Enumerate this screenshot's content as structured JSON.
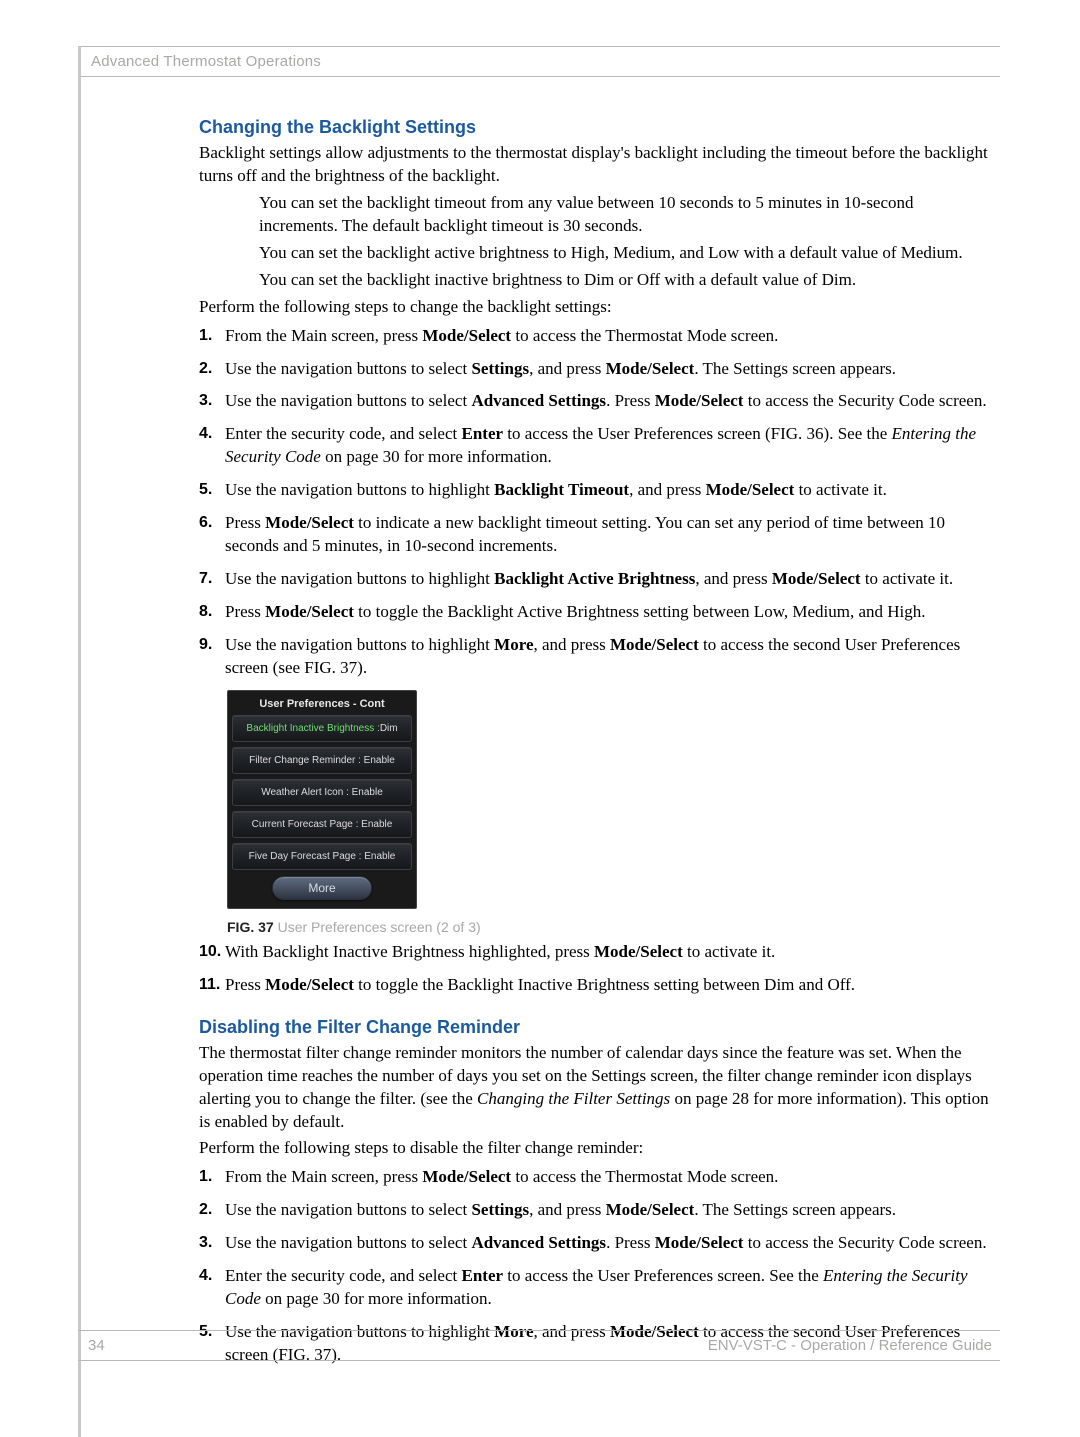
{
  "header": {
    "chapter": "Advanced Thermostat Operations"
  },
  "footer": {
    "page": "34",
    "guide": "ENV-VST-C - Operation / Reference Guide"
  },
  "section1": {
    "title": "Changing the Backlight Settings",
    "intro": "Backlight settings allow adjustments to the thermostat display's backlight including the timeout before the backlight turns off and the brightness of the backlight.",
    "bullets": {
      "b1": "You can set the backlight timeout from any value between 10 seconds to 5 minutes in 10-second increments. The default backlight timeout is 30 seconds.",
      "b2": "You can set the backlight active brightness to High, Medium, and Low with a default value of Medium.",
      "b3": "You can set the backlight inactive brightness to Dim or Off with a default value of Dim."
    },
    "lead": "Perform the following steps to change the backlight settings:",
    "steps": {
      "s1a": "From the Main screen, press ",
      "s1b": "Mode/Select",
      "s1c": " to access the Thermostat Mode screen.",
      "s2a": "Use the navigation buttons to select ",
      "s2b": "Settings",
      "s2c": ", and press ",
      "s2d": "Mode/Select",
      "s2e": ". The Settings screen appears.",
      "s3a": "Use the navigation buttons to select ",
      "s3b": "Advanced Settings",
      "s3c": ". Press ",
      "s3d": "Mode/Select",
      "s3e": " to access the Security Code screen.",
      "s4a": "Enter the security code, and select ",
      "s4b": "Enter",
      "s4c": " to access the User Preferences screen (FIG. 36). See the ",
      "s4d": "Entering the Security Code",
      "s4e": "  on page 30 for more information.",
      "s5a": "Use the navigation buttons to highlight ",
      "s5b": "Backlight Timeout",
      "s5c": ", and press ",
      "s5d": "Mode/Select",
      "s5e": " to activate it.",
      "s6a": "Press ",
      "s6b": "Mode/Select",
      "s6c": " to indicate a new backlight timeout setting. You can set any period of time between 10 seconds and 5 minutes, in 10-second increments.",
      "s7a": "Use the navigation buttons to highlight ",
      "s7b": "Backlight Active Brightness",
      "s7c": ", and press ",
      "s7d": "Mode/Select",
      "s7e": " to activate it.",
      "s8a": "Press ",
      "s8b": "Mode/Select",
      "s8c": " to toggle the Backlight Active Brightness setting between Low, Medium, and High.",
      "s9a": "Use the navigation buttons to highlight ",
      "s9b": "More",
      "s9c": ", and press ",
      "s9d": "Mode/Select",
      "s9e": " to access the second User Preferences screen (see FIG. 37).",
      "s10a": "With Backlight Inactive Brightness highlighted, press ",
      "s10b": "Mode/Select",
      "s10c": " to activate it.",
      "s11a": "Press ",
      "s11b": "Mode/Select",
      "s11c": " to toggle the Backlight Inactive Brightness setting between Dim and Off."
    }
  },
  "figure": {
    "num": "FIG. 37",
    "caption": "  User Preferences screen (2 of 3)",
    "device_title": "User Preferences - Cont",
    "items": {
      "i1l": "Backlight Inactive Brightness :",
      "i1v": "Dim",
      "i2": "Filter Change Reminder : Enable",
      "i3": "Weather Alert Icon : Enable",
      "i4": "Current Forecast Page : Enable",
      "i5": "Five Day Forecast Page : Enable"
    },
    "more": "More"
  },
  "section2": {
    "title": "Disabling the Filter Change Reminder",
    "intro_a": "The thermostat filter change reminder monitors the number of calendar days since the feature was set. When the operation time reaches the number of days you set on the Settings screen, the filter change reminder icon displays alerting you to change the filter. (see the ",
    "intro_b": "Changing the Filter Settings",
    "intro_c": "  on page 28 for more information). This option is enabled by default.",
    "lead": "Perform the following steps to disable the filter change reminder:",
    "steps": {
      "s1a": "From the Main screen, press ",
      "s1b": "Mode/Select",
      "s1c": " to access the Thermostat Mode screen.",
      "s2a": "Use the navigation buttons to select ",
      "s2b": "Settings",
      "s2c": ", and press ",
      "s2d": "Mode/Select",
      "s2e": ". The Settings screen appears.",
      "s3a": "Use the navigation buttons to select ",
      "s3b": "Advanced Settings",
      "s3c": ". Press ",
      "s3d": "Mode/Select",
      "s3e": " to access the Security Code screen.",
      "s4a": "Enter the security code, and select ",
      "s4b": "Enter",
      "s4c": " to access the User Preferences screen. See the ",
      "s4d": "Entering the Security Code",
      "s4e": "  on page 30 for more information.",
      "s5a": "Use the navigation buttons to highlight ",
      "s5b": "More",
      "s5c": ", and press ",
      "s5d": "Mode/Select",
      "s5e": " to access the second User Preferences screen (FIG. 37)."
    }
  },
  "numbers": {
    "n1": "1.",
    "n2": "2.",
    "n3": "3.",
    "n4": "4.",
    "n5": "5.",
    "n6": "6.",
    "n7": "7.",
    "n8": "8.",
    "n9": "9.",
    "n10": "10.",
    "n11": "11."
  }
}
